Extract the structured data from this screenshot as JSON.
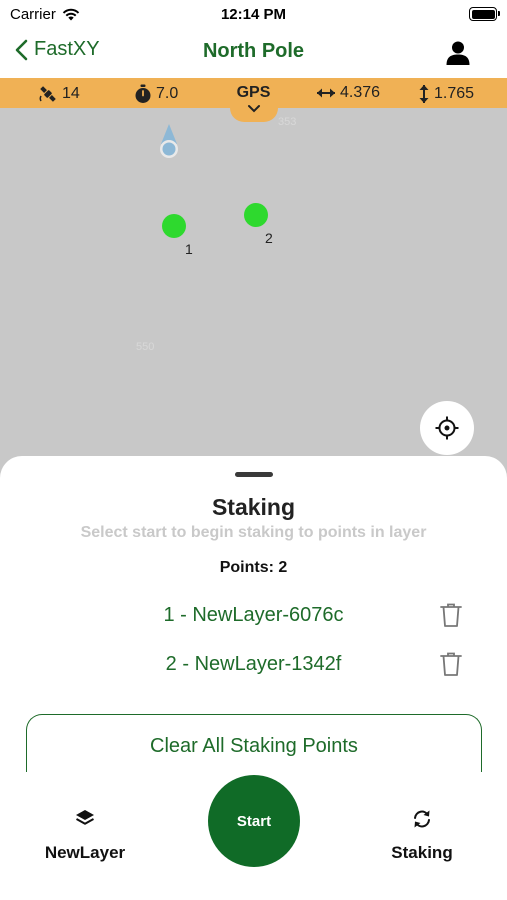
{
  "status_bar": {
    "carrier": "Carrier",
    "time": "12:14 PM"
  },
  "nav": {
    "back_label": "FastXY",
    "title": "North Pole"
  },
  "gps_bar": {
    "satellites": "14",
    "timer": "7.0",
    "mode": "GPS",
    "horizontal": "4.376",
    "vertical": "1.765"
  },
  "map": {
    "faint_label_top": "353",
    "faint_label_mid": "550",
    "points": [
      {
        "label": "1"
      },
      {
        "label": "2"
      }
    ]
  },
  "sheet": {
    "title": "Staking",
    "subtitle": "Select start to begin staking to points in layer",
    "points_count": "Points: 2",
    "items": [
      {
        "label": "1 - NewLayer-6076c"
      },
      {
        "label": "2 - NewLayer-1342f"
      }
    ],
    "clear_label": "Clear All Staking Points"
  },
  "toolbar": {
    "left_label": "NewLayer",
    "start_label": "Start",
    "right_label": "Staking"
  },
  "colors": {
    "brand_green": "#1e6b2a",
    "start_green": "#106b27",
    "gps_orange": "#f0b155",
    "point_green": "#2ed92e",
    "map_gray": "#c8c8c8"
  }
}
